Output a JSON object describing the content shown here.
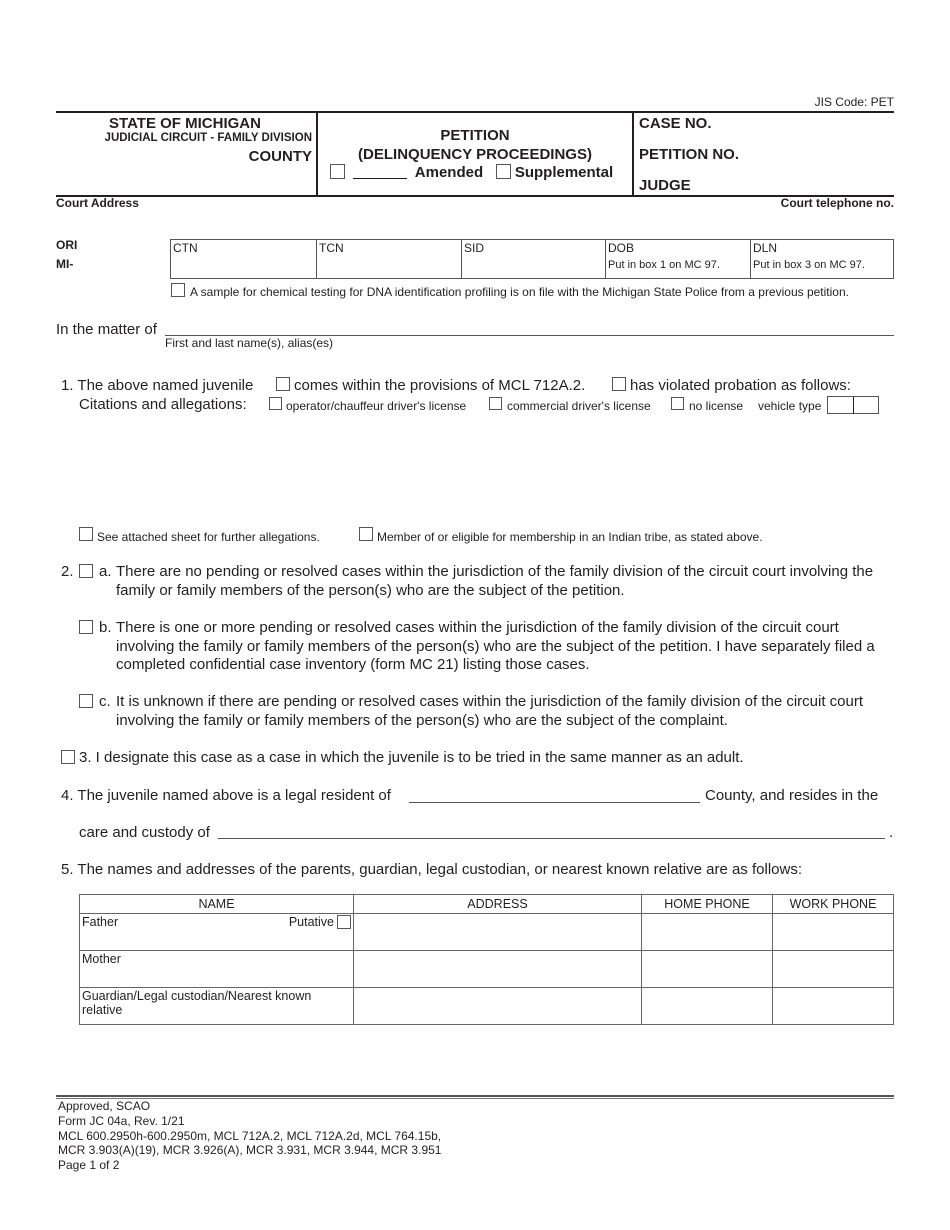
{
  "header": {
    "jis_code": "JIS Code: PET",
    "state": "STATE OF MICHIGAN",
    "circuit": "JUDICIAL CIRCUIT - FAMILY DIVISION",
    "county": "COUNTY",
    "title": "PETITION",
    "subtitle": "(DELINQUENCY PROCEEDINGS)",
    "amended_label": "Amended",
    "supplemental_label": "Supplemental",
    "case_no_label": "CASE NO.",
    "petition_no_label": "PETITION NO.",
    "judge_label": "JUDGE",
    "court_address_label": "Court Address",
    "court_telephone_label": "Court telephone no."
  },
  "identifiers": {
    "ori_label": "ORI",
    "mi_label": "MI-",
    "cells": [
      {
        "label": "CTN",
        "note": ""
      },
      {
        "label": "TCN",
        "note": ""
      },
      {
        "label": "SID",
        "note": ""
      },
      {
        "label": "DOB",
        "note": "Put in box 1 on MC 97."
      },
      {
        "label": "DLN",
        "note": "Put in box 3 on MC 97."
      }
    ],
    "dna_text": "A sample for chemical testing for DNA identification profiling is on file with the Michigan State Police from a previous petition."
  },
  "matter": {
    "label": "In the matter of",
    "value": "",
    "sublabel": "First and last name(s), alias(es)"
  },
  "item1": {
    "lead": "1. The above named juvenile",
    "option1": "comes within the provisions of MCL 712A.2.",
    "option2": "has violated probation as follows:",
    "citations_label": "Citations and allegations:",
    "license_options": [
      "operator/chauffeur driver's license",
      "commercial driver's license",
      "no license"
    ],
    "vehicle_type_label": "vehicle type",
    "further_allegations": "See attached sheet for further allegations.",
    "indian_tribe": "Member of or eligible for membership in an Indian tribe, as stated above."
  },
  "item2": {
    "num": "2.",
    "a_letter": "a.",
    "a_text": "There are no pending or resolved cases within the jurisdiction of the family division of the circuit court involving the family or family members of the person(s) who are the subject of the petition.",
    "b_letter": "b.",
    "b_text": "There is one or more pending or resolved cases within the jurisdiction of the family division of the circuit court involving the family or family members of the person(s) who are the subject of the petition. I have separately filed a completed confidential case inventory (form MC 21) listing those cases.",
    "c_letter": "c.",
    "c_text": "It is unknown if there are pending or resolved cases within the jurisdiction of the family division of the circuit court involving the family or family members of the person(s) who are the subject of the complaint."
  },
  "item3": {
    "text": "3. I designate this case as a case in which the juvenile is to be tried in the same manner as an adult."
  },
  "item4": {
    "text1": "4. The juvenile named above is a legal resident of",
    "text2": "County, and resides in the",
    "text3": "care and custody of",
    "end": "."
  },
  "item5": {
    "text": "5. The names and addresses of the parents, guardian, legal custodian, or nearest known relative are as follows:",
    "columns": [
      "NAME",
      "ADDRESS",
      "HOME PHONE",
      "WORK PHONE"
    ],
    "rows": [
      {
        "name": "Father",
        "address": "",
        "home_phone": "",
        "work_phone": ""
      },
      {
        "name": "Mother",
        "address": "",
        "home_phone": "",
        "work_phone": ""
      },
      {
        "name": "Guardian/Legal custodian/Nearest known relative",
        "address": "",
        "home_phone": "",
        "work_phone": ""
      }
    ],
    "putative_label": "Putative"
  },
  "footer": {
    "lines": [
      "Approved, SCAO",
      "Form JC 04a, Rev. 1/21",
      "MCL 600.2950h-600.2950m, MCL 712A.2, MCL 712A.2d, MCL 764.15b,",
      "MCR 3.903(A)(19), MCR 3.926(A), MCR 3.931, MCR 3.944, MCR 3.951",
      "Page 1 of 2"
    ]
  }
}
